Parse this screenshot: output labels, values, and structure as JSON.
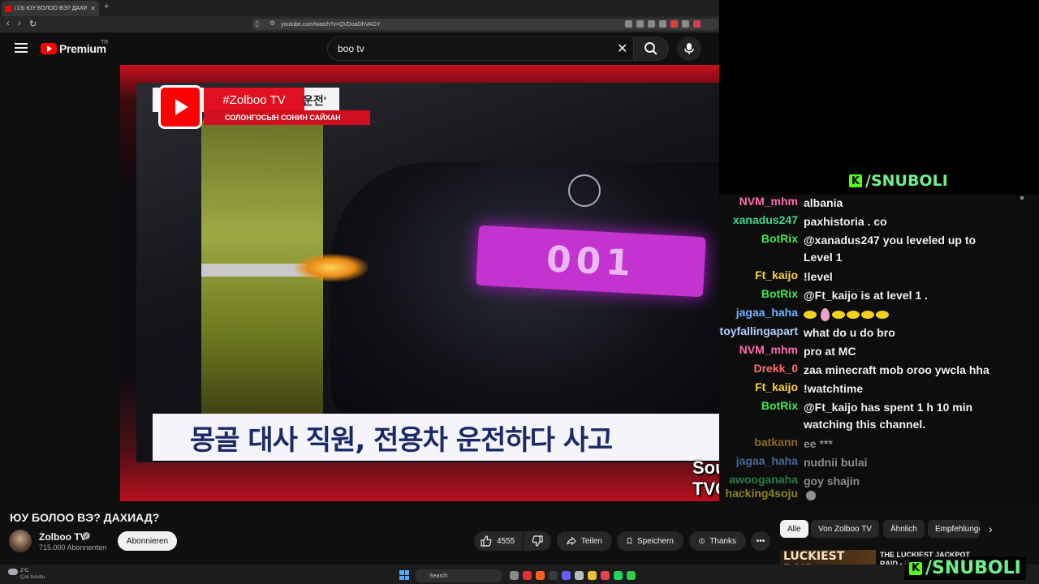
{
  "browser": {
    "tab_title": "(13) ЮУ БОЛОО ВЭ? ДАХИАД...",
    "tab_close": "✕",
    "new_tab": "+",
    "url": "youtube.com/watch?v=QVDoaDhVAOY",
    "back": "‹",
    "forward": "›",
    "reload": "↻",
    "ext_colors": [
      "#8a8a8a",
      "#8a8a8a",
      "#8a8a8a",
      "#8a8a8a",
      "#e04040",
      "#8a8a8a",
      "#d04050"
    ]
  },
  "youtube": {
    "logo_text": "Premium",
    "logo_region": "TR",
    "search": {
      "value": "boo tv",
      "clear": "✕"
    }
  },
  "video": {
    "overlay_logo": "#Zolboo TV",
    "overlay_korean": "운전'",
    "overlay_sub": "СОЛОНГОСЫН СОНИН САЙХАН",
    "plate": "001",
    "caption": "몽골 대사 직원, 전용차 운전하다 사고",
    "source": "Source: TVCHOSUN"
  },
  "stream": {
    "brand_top": "/SNUBOLI",
    "brand_bottom": "/SNUBOLI",
    "kick_glyph": "K"
  },
  "chat": [
    {
      "user": "NVM_mhm",
      "color": "#ff6bb0",
      "text": "albania"
    },
    {
      "user": "xanadus247",
      "color": "#3fd88a",
      "text": "paxhistoria . co"
    },
    {
      "user": "BotRix",
      "color": "#3ee84a",
      "text": "@xanadus247 you leveled up to Level 1"
    },
    {
      "user": "Ft_kaijo",
      "color": "#ffd43b",
      "text": "!level"
    },
    {
      "user": "BotRix",
      "color": "#3ee84a",
      "text": "@Ft_kaijo is at level 1 ."
    },
    {
      "user": "jagaa_haha",
      "color": "#6fb3ff",
      "text": ""
    },
    {
      "user": "estoyfallingapart",
      "color": "#b0d0ff",
      "text": "what do u do bro"
    },
    {
      "user": "NVM_mhm",
      "color": "#ff6bb0",
      "text": "pro at MC"
    },
    {
      "user": "Drekk_0",
      "color": "#ff6b6b",
      "text": "zaa minecraft mob oroo ywcla hha"
    },
    {
      "user": "Ft_kaijo",
      "color": "#ffd43b",
      "text": "!watchtime"
    },
    {
      "user": "BotRix",
      "color": "#3ee84a",
      "text": "@Ft_kaijo has spent 1 h 10 min watching this channel."
    },
    {
      "user": "batkann",
      "color": "#ffb040",
      "text": "ee ***"
    },
    {
      "user": "jagaa_haha",
      "color": "#6fb3ff",
      "text": "nudnii bulai"
    },
    {
      "user": "awooganaha",
      "color": "#3fd86a",
      "text": "goy shajin"
    },
    {
      "user": "hacking4soju",
      "color": "#f0e040",
      "text": ""
    }
  ],
  "info": {
    "title": "ЮУ БОЛОО ВЭ? ДАХИАД?",
    "channel": "Zolboo TV",
    "verified": "✓",
    "subscribers": "715.000 Abonnenten",
    "subscribe_label": "Abonnieren",
    "likes": "4555",
    "share_label": "Teilen",
    "save_label": "Speichern",
    "thanks_label": "Thanks",
    "more": "•••"
  },
  "chips": [
    "Alle",
    "Von Zolboo TV",
    "Ähnlich",
    "Empfehlungen"
  ],
  "chip_next": "›",
  "recommendation": {
    "thumb_text": "LUCKIEST RAID",
    "title": "THE LUCKIEST JACKPOT RAID - Rust"
  },
  "taskbar": {
    "temp": "2°C",
    "weather": "Çok bulutlu",
    "search": "Search",
    "icon_colors": [
      "#888",
      "#e03030",
      "#ff6020",
      "#3a3a3a",
      "#6a5cff",
      "#bbb",
      "#f0c030",
      "#e04050",
      "#1ed760",
      "#2ecc40"
    ]
  }
}
